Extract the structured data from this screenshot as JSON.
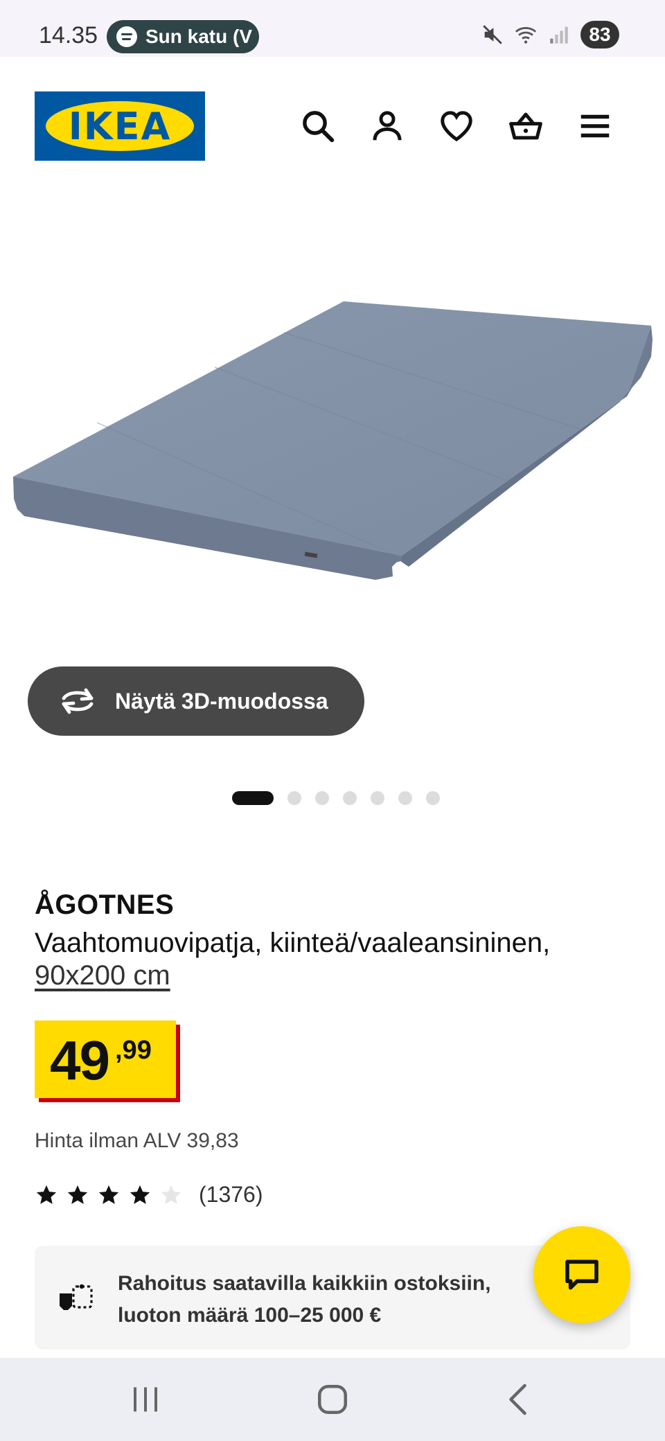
{
  "status_bar": {
    "time": "14.35",
    "media_text": "Sun katu (V",
    "battery": "83",
    "icons": [
      "spotify-icon",
      "mute-icon",
      "wifi-icon",
      "signal-icon",
      "battery-icon"
    ]
  },
  "header": {
    "logo_text": "IKEA",
    "icons": [
      "search-icon",
      "account-icon",
      "favorites-icon",
      "cart-icon",
      "menu-icon"
    ]
  },
  "gallery": {
    "view_3d_label": "Näytä 3D-muodossa",
    "dot_count": 7,
    "active_index": 0
  },
  "product": {
    "name": "ÅGOTNES",
    "description": "Vaahtomuovipatja, kiinteä/vaaleansininen,",
    "size": "90x200 cm",
    "price_int": "49",
    "price_dec": ",99",
    "vat_text": "Hinta ilman ALV 39,83",
    "rating": 4,
    "rating_max": 5,
    "review_count": "(1376)"
  },
  "finance": {
    "line1": "Rahoitus saatavilla kaikkiin ostoksiin,",
    "line2": "luoton määrä 100–25 000 €"
  },
  "colors": {
    "ikea_blue": "#0058a3",
    "ikea_yellow": "#ffdb00",
    "price_shadow_red": "#cc0008"
  }
}
